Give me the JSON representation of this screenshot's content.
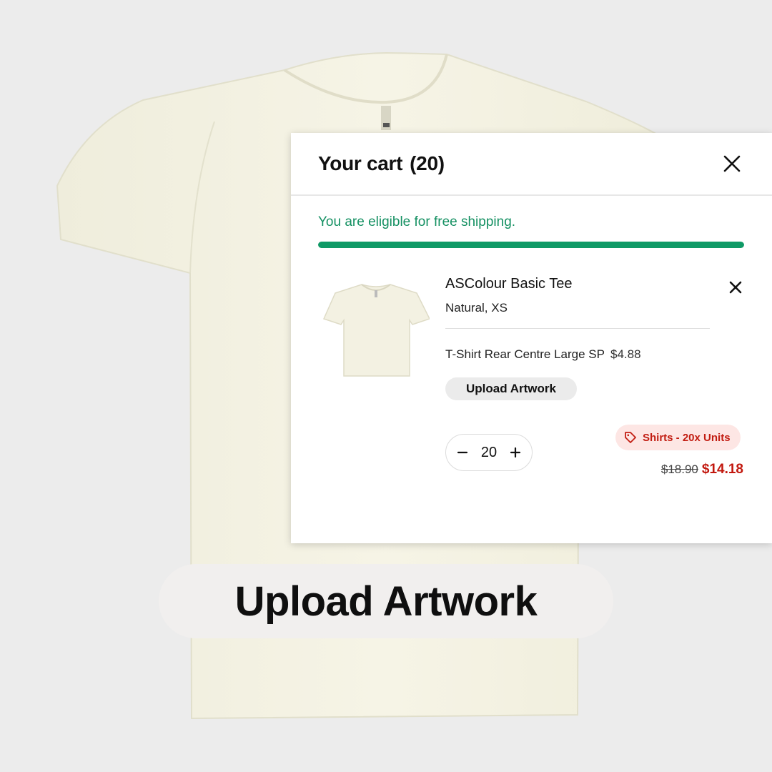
{
  "cart": {
    "title": "Your cart",
    "count": "(20)",
    "free_shipping_message": "You are eligible for free shipping.",
    "free_shipping_progress": 1.0,
    "accent_color": "#0f9a66"
  },
  "item": {
    "name": "ASColour Basic Tee",
    "variant": "Natural, XS",
    "addon_label": "T-Shirt Rear Centre Large SP",
    "addon_price": "$4.88",
    "upload_label": "Upload Artwork",
    "quantity": "20",
    "discount_badge": "Shirts - 20x Units",
    "original_price": "$18.90",
    "sale_price": "$14.18",
    "sale_color": "#c2170d"
  },
  "cta": {
    "upload_label": "Upload Artwork"
  },
  "icons": {
    "close": "close-icon",
    "remove": "remove-item-icon",
    "minus": "minus-icon",
    "plus": "plus-icon",
    "tag": "tag-icon"
  }
}
